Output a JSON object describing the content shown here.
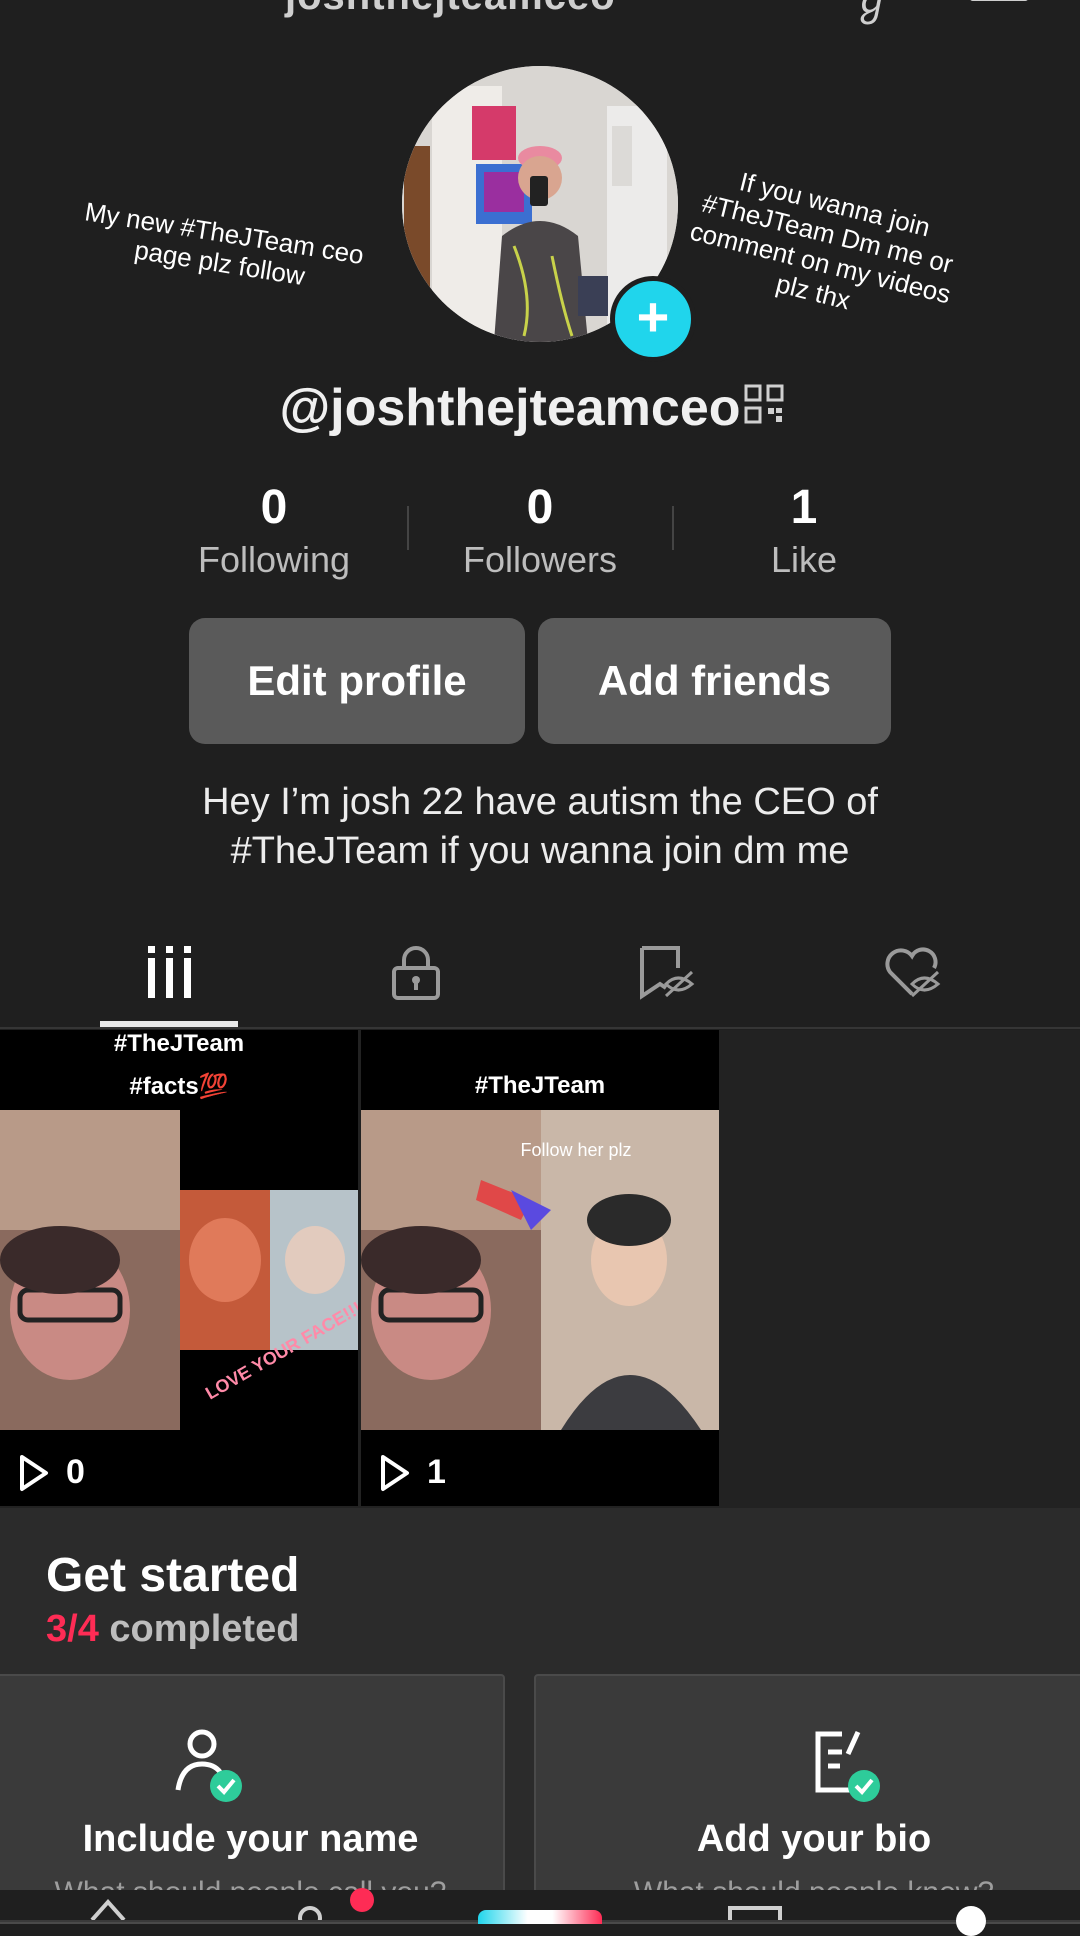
{
  "header": {
    "username_cut": "joshthejteamceo",
    "menu_icon": "hamburger-icon"
  },
  "profile": {
    "handle": "@joshthejteamceo",
    "sticker_left": "My new #TheJTeam ceo page plz follow",
    "sticker_right": "If you wanna join #TheJTeam Dm me or comment on my videos plz thx",
    "bio_line1": "Hey I’m josh 22 have autism the CEO of",
    "bio_line2": "#TheJTeam if you wanna join dm me"
  },
  "stats": [
    {
      "value": "0",
      "label": "Following"
    },
    {
      "value": "0",
      "label": "Followers"
    },
    {
      "value": "1",
      "label": "Like"
    }
  ],
  "buttons": {
    "edit_profile": "Edit profile",
    "add_friends": "Add friends"
  },
  "tabs": [
    "videos-grid-icon",
    "lock-icon",
    "bookmark-hidden-icon",
    "liked-hidden-icon"
  ],
  "videos": [
    {
      "caption_1": "#TheJTeam",
      "caption_2": "#facts💯",
      "overlay": "LOVE YOUR FACE!!!!!",
      "views": "0"
    },
    {
      "caption_1": "#TheJTeam",
      "overlay": "Follow her plz",
      "views": "1"
    }
  ],
  "get_started": {
    "title": "Get started",
    "progress_done": "3/4",
    "progress_label": "completed",
    "cards": [
      {
        "title": "Include your name",
        "subtitle": "What should people call you?"
      },
      {
        "title": "Add your bio",
        "subtitle": "What should people know?"
      }
    ]
  },
  "colors": {
    "accent": "#fe2c55",
    "add_button": "#20d5ec",
    "check": "#2ecc9a"
  }
}
